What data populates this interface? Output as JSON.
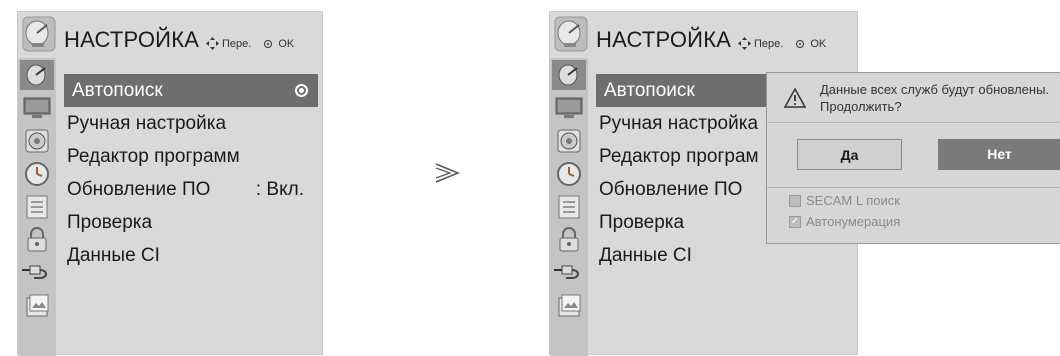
{
  "left": {
    "title": "НАСТРОЙКА",
    "hint_move": "Пере.",
    "hint_ok": "OK",
    "menu": [
      {
        "label": "Автопоиск",
        "value": "",
        "selected": true
      },
      {
        "label": "Ручная настройка",
        "value": ""
      },
      {
        "label": "Редактор программ",
        "value": ""
      },
      {
        "label": "Обновление ПО",
        "value": ": Вкл."
      },
      {
        "label": "Проверка",
        "value": ""
      },
      {
        "label": "Данные CI",
        "value": ""
      }
    ]
  },
  "right": {
    "title": "НАСТРОЙКА",
    "hint_move": "Пере.",
    "hint_ok": "OK",
    "menu": [
      {
        "label": "Автопоиск",
        "selected": true
      },
      {
        "label": "Ручная настройка"
      },
      {
        "label": "Редактор програм"
      },
      {
        "label": "Обновление ПО"
      },
      {
        "label": "Проверка"
      },
      {
        "label": "Данные CI"
      }
    ]
  },
  "dialog": {
    "message_line1": "Данные всех служб будут обновлены.",
    "message_line2": "Продолжить?",
    "yes_label": "Да",
    "no_label": "Нет",
    "option1": "SECAM L поиск",
    "option1_checked": false,
    "option2": "Автонумерация",
    "option2_checked": true
  },
  "sidebar_icons": [
    "satellite-dish-icon",
    "monitor-icon",
    "speaker-icon",
    "clock-icon",
    "checklist-icon",
    "lock-icon",
    "input-plug-icon",
    "photo-card-icon"
  ],
  "colors": {
    "panel_bg": "#d9d9d9",
    "selected_bg": "#6e6e6e",
    "no_button_bg": "#7a7a7a"
  }
}
